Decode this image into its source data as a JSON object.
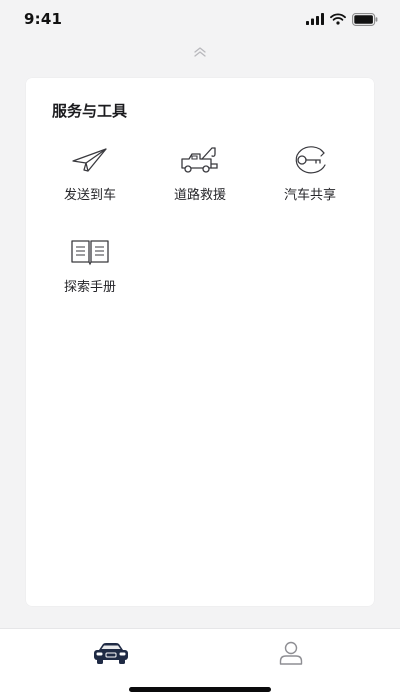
{
  "status_bar": {
    "time": "9:41",
    "icons": [
      "cellular-signal-icon",
      "wifi-icon",
      "battery-icon"
    ]
  },
  "collapse_icon": "double-chevron-up-icon",
  "card": {
    "title": "服务与工具",
    "tools": [
      {
        "label": "发送到车",
        "icon": "paper-plane-icon"
      },
      {
        "label": "道路救援",
        "icon": "tow-truck-icon"
      },
      {
        "label": "汽车共享",
        "icon": "car-key-share-icon"
      },
      {
        "label": "探索手册",
        "icon": "open-book-icon"
      }
    ]
  },
  "tab_bar": {
    "tabs": [
      {
        "icon": "car-icon",
        "active": true
      },
      {
        "icon": "user-icon",
        "active": false
      }
    ]
  },
  "colors": {
    "background": "#f3f3f4",
    "card": "#ffffff",
    "active_tab": "#1f2a44",
    "inactive_tab": "#8e8e93",
    "icon_stroke": "#3a3a3f"
  }
}
